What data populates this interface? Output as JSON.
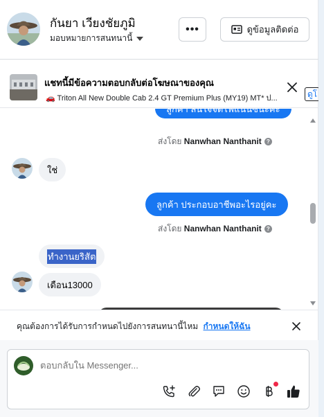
{
  "header": {
    "name": "กันยา เวียงชัยภูมิ",
    "assign_label": "มอบหมายการสนทนานี้",
    "more_label": "•••",
    "contact_label": "ดูข้อมูลติดต่อ"
  },
  "banner": {
    "title": "แชทนี้มีข้อความตอบกลับต่อโฆษณาของคุณ",
    "subtitle": "🚗 Triton All New Double Cab 2.4 GT Premium Plus (MY19) MT* ป...",
    "cut_label": "ดูโ"
  },
  "messages": {
    "out1": "ลูกค้า สนใจจัดไฟแนนซ์นะคะ",
    "sent_prefix": "ส่งโดย",
    "sender": "Nanwhan Nanthanit",
    "in1": "ใช่",
    "out2": "ลูกค้า  ประกอบอาชีพอะไรอยู่คะ",
    "in2": "ทำงานยริสัต",
    "in3": "เดือน13000"
  },
  "prompt": {
    "text": "คุณต้องการได้รับการกำหนดไปยังการสนทนานี้ไหม",
    "link": "กำหนดให้ฉัน"
  },
  "composer": {
    "placeholder": "ตอบกลับใน Messenger..."
  },
  "colors": {
    "accent": "#1877f2",
    "bubble_in": "#f0f2f5",
    "notification_dot": "#f02849"
  }
}
